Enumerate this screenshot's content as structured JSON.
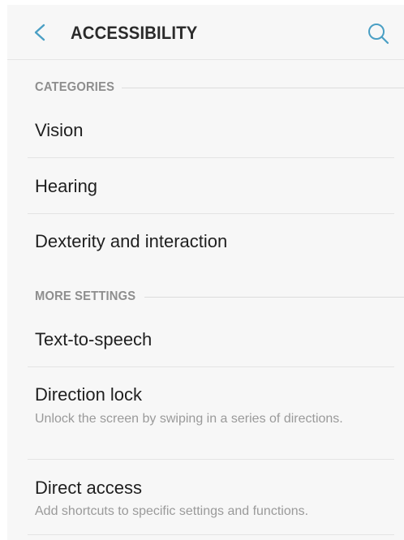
{
  "header": {
    "title": "ACCESSIBILITY",
    "back_icon": "chevron-left-icon",
    "search_icon": "search-icon"
  },
  "sections": [
    {
      "label": "CATEGORIES",
      "items": [
        {
          "title": "Vision"
        },
        {
          "title": "Hearing"
        },
        {
          "title": "Dexterity and interaction"
        }
      ]
    },
    {
      "label": "MORE SETTINGS",
      "items": [
        {
          "title": "Text-to-speech"
        },
        {
          "title": "Direction lock",
          "subtitle": "Unlock the screen by swiping in a series of directions."
        },
        {
          "title": "Direct access",
          "subtitle": "Add shortcuts to specific settings and functions."
        }
      ]
    }
  ],
  "colors": {
    "accent": "#4a9fc4",
    "background": "#f7f7f7",
    "title_text": "#1f1f1f",
    "section_label": "#8e8e8e",
    "subtitle_text": "#9a9a9a"
  }
}
